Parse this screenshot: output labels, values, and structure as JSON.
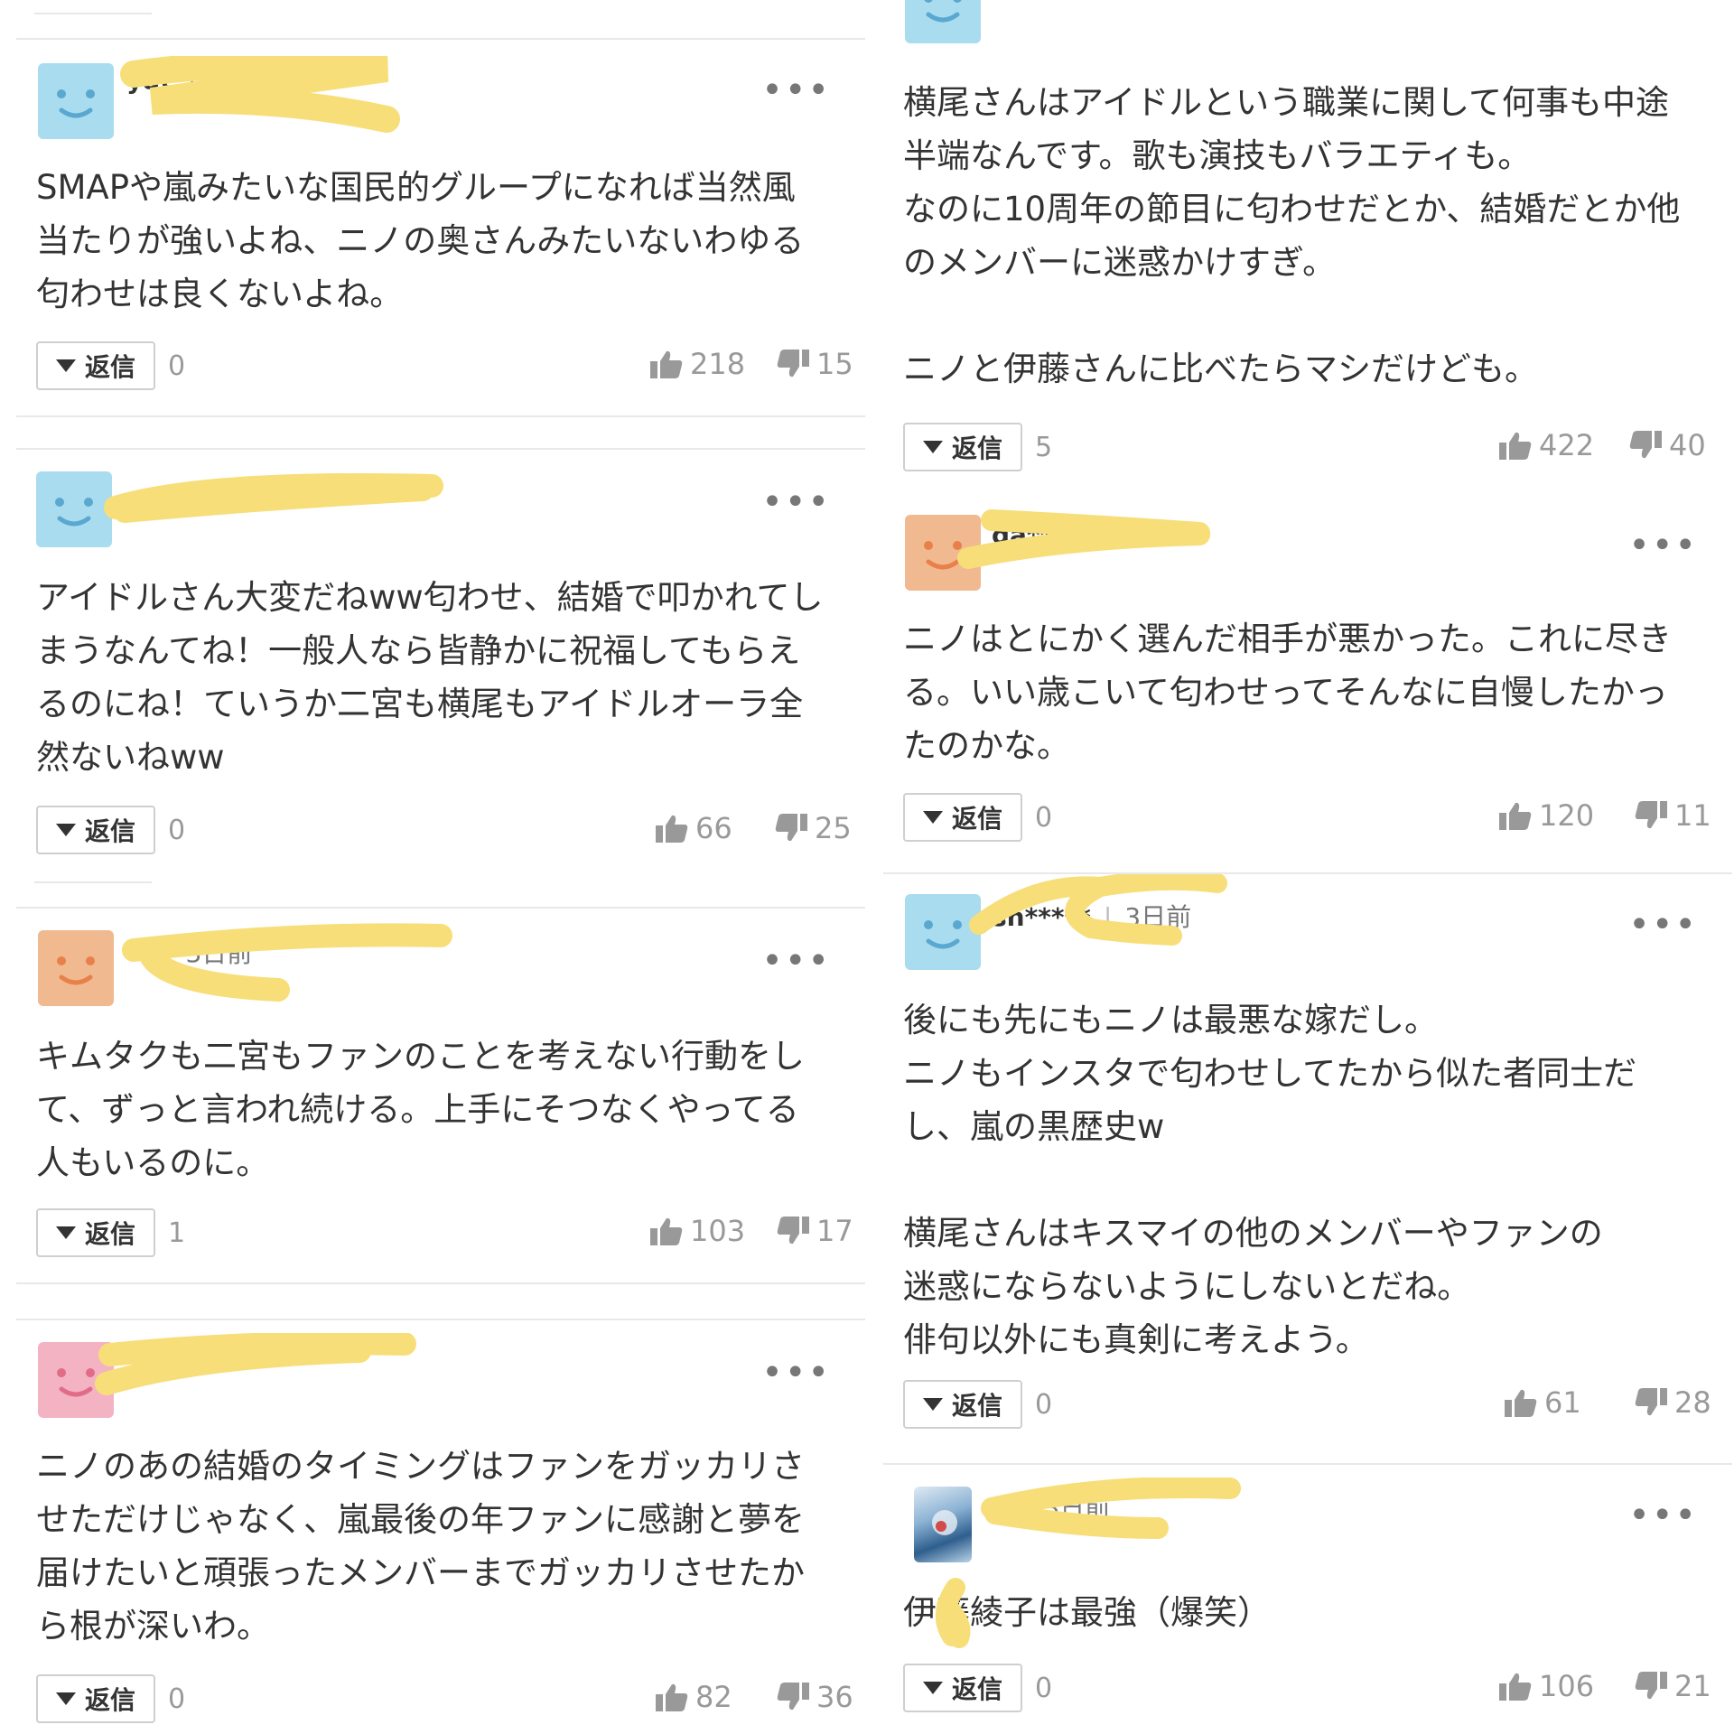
{
  "labels": {
    "reply": "返信"
  },
  "left_column": [
    {
      "avatar": "blue-smiley",
      "user": "yat*****",
      "time": "",
      "text": "SMAPや嵐みたいな国民的グループになれば当然風\n当たりが強いよね、ニノの奥さんみたいないわゆる\n匂わせは良くないよね。",
      "replies": "0",
      "likes": "218",
      "dislikes": "15"
    },
    {
      "avatar": "blue-smiley",
      "user": "",
      "time": "",
      "text": "アイドルさん大変だねww匂わせ、結婚で叩かれてし\nまうなんてね！一般人なら皆静かに祝福してもらえ\nるのにね！ていうか二宮も横尾もアイドルオーラ全\n然ないねww",
      "replies": "0",
      "likes": "66",
      "dislikes": "25"
    },
    {
      "avatar": "orange-smiley",
      "user": "",
      "time": "3日前",
      "text": "キムタクも二宮もファンのことを考えない行動をし\nて、ずっと言われ続ける。上手にそつなくやってる\n人もいるのに。",
      "replies": "1",
      "likes": "103",
      "dislikes": "17"
    },
    {
      "avatar": "pink-smiley",
      "user": "",
      "time": "",
      "text": "ニノのあの結婚のタイミングはファンをガッカリさ\nせただけじゃなく、嵐最後の年ファンに感謝と夢を\n届けたいと頑張ったメンバーまでガッカリさせたか\nら根が深いわ。",
      "replies": "0",
      "likes": "82",
      "dislikes": "36"
    }
  ],
  "right_column": [
    {
      "avatar": "blue-smiley",
      "user": "",
      "time": "",
      "text": "横尾さんはアイドルという職業に関して何事も中途\n半端なんです。歌も演技もバラエティも。\nなのに10周年の節目に匂わせだとか、結婚だとか他\nのメンバーに迷惑かけすぎ。\n\nニノと伊藤さんに比べたらマシだけども。",
      "replies": "5",
      "likes": "422",
      "dislikes": "40"
    },
    {
      "avatar": "orange-smiley",
      "user": "ga*****",
      "time": "",
      "text": "ニノはとにかく選んだ相手が悪かった。これに尽き\nる。いい歳こいて匂わせってそんなに自慢したかっ\nたのかな。",
      "replies": "0",
      "likes": "120",
      "dislikes": "11"
    },
    {
      "avatar": "blue-smiley",
      "user": "sh*****",
      "time": "3日前",
      "text": "後にも先にもニノは最悪な嫁だし。\nニノもインスタで匂わせしてたから似た者同士だ\nし、嵐の黒歴史w\n\n横尾さんはキスマイの他のメンバーやファンの\n迷惑にならないようにしないとだね。\n俳句以外にも真剣に考えよう。",
      "replies": "0",
      "likes": "61",
      "dislikes": "28"
    },
    {
      "avatar": "photo",
      "user": "",
      "time": "3日前",
      "text": "伊藤綾子は最強（爆笑）",
      "replies": "0",
      "likes": "106",
      "dislikes": "21"
    }
  ],
  "colors": {
    "scribble": "#f7de79",
    "avatar_blue": "#a9dcef",
    "avatar_orange": "#f1b990",
    "avatar_pink": "#f3b3c2",
    "muted": "#999999"
  },
  "icons": [
    "smiley-face-icon",
    "more-dots-icon",
    "caret-down-icon",
    "thumbs-up-icon",
    "thumbs-down-icon"
  ]
}
